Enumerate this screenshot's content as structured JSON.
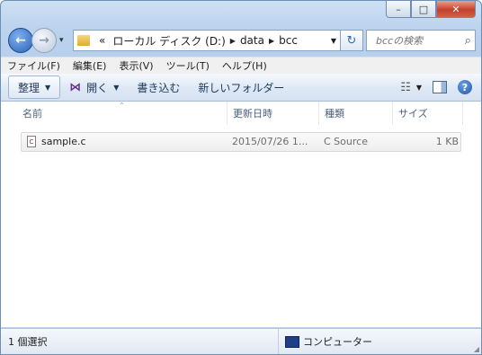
{
  "window": {
    "caption_buttons": [
      "minimize-icon",
      "maximize-icon",
      "close-icon"
    ]
  },
  "address": {
    "crumbs": [
      "ローカル ディスク (D:)",
      "data",
      "bcc"
    ],
    "overflow": "«"
  },
  "search": {
    "placeholder": "bccの検索"
  },
  "menubar": [
    "ファイル(F)",
    "編集(E)",
    "表示(V)",
    "ツール(T)",
    "ヘルプ(H)"
  ],
  "toolbar": {
    "organize": "整理",
    "open": "開く",
    "burn": "書き込む",
    "new_folder": "新しいフォルダー"
  },
  "columns": {
    "name": "名前",
    "date": "更新日時",
    "type": "種類",
    "size": "サイズ"
  },
  "files": [
    {
      "name": "sample.c",
      "date": "2015/07/26 1...",
      "type": "C Source",
      "size": "1 KB",
      "icon": "c"
    }
  ],
  "status": {
    "selection": "1 個選択",
    "location": "コンピューター"
  },
  "colors": {
    "title_gradient": "#bcd3ee",
    "accent": "#2b62b6"
  }
}
